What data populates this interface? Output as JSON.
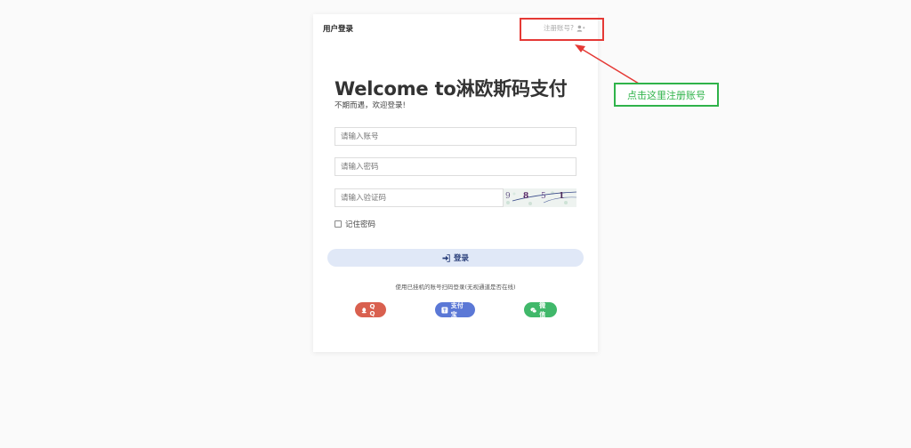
{
  "card": {
    "title": "用户登录",
    "register_link": "注册账号?",
    "welcome": "Welcome to淋欧斯码支付",
    "subtitle": "不期而遇，欢迎登录!",
    "username_placeholder": "请输入账号",
    "password_placeholder": "请输入密码",
    "code_placeholder": "请输入验证码",
    "captcha_chars": [
      "9",
      "8",
      "5",
      "1"
    ],
    "remember_label": "记住密码",
    "login_label": "登录",
    "scan_tip": "使用已挂机的账号扫码登录(无视通道是否在线)",
    "social": {
      "qq": "Q Q",
      "alipay": "支付宝",
      "wechat": "微信"
    }
  },
  "annotation": {
    "label": "点击这里注册账号",
    "box_color": "#e53935",
    "label_color": "#2fb34a"
  },
  "colors": {
    "login_bg": "#e0e8f7",
    "qq": "#d9604f",
    "alipay": "#5b78d6",
    "wechat": "#40b86a"
  }
}
